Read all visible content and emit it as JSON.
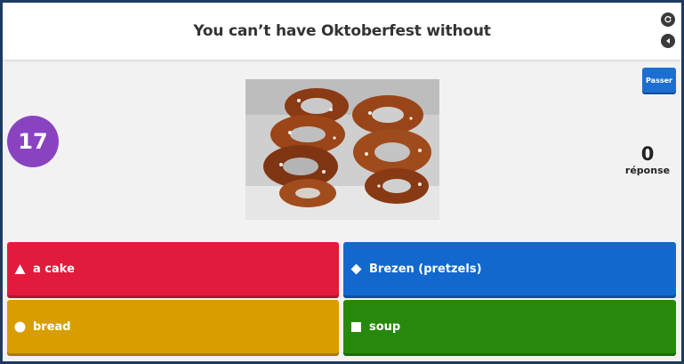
{
  "header": {
    "question": "You can’t have Oktoberfest without",
    "icon_top": "refresh-icon",
    "icon_bottom": "back-icon"
  },
  "skip_button": {
    "label": "Passer"
  },
  "timer": {
    "value": "17",
    "color": "#8a43c0"
  },
  "answers_count": {
    "value": "0",
    "label": "réponse"
  },
  "media": {
    "icon": "pretzel-photo"
  },
  "answers": [
    {
      "label": "a cake",
      "shape": "triangle-icon",
      "color": "#e21b3c"
    },
    {
      "label": "Brezen (pretzels)",
      "shape": "diamond-icon",
      "color": "#1368ce"
    },
    {
      "label": "bread",
      "shape": "circle-icon",
      "color": "#d89e00"
    },
    {
      "label": "soup",
      "shape": "square-icon",
      "color": "#26890c"
    }
  ]
}
